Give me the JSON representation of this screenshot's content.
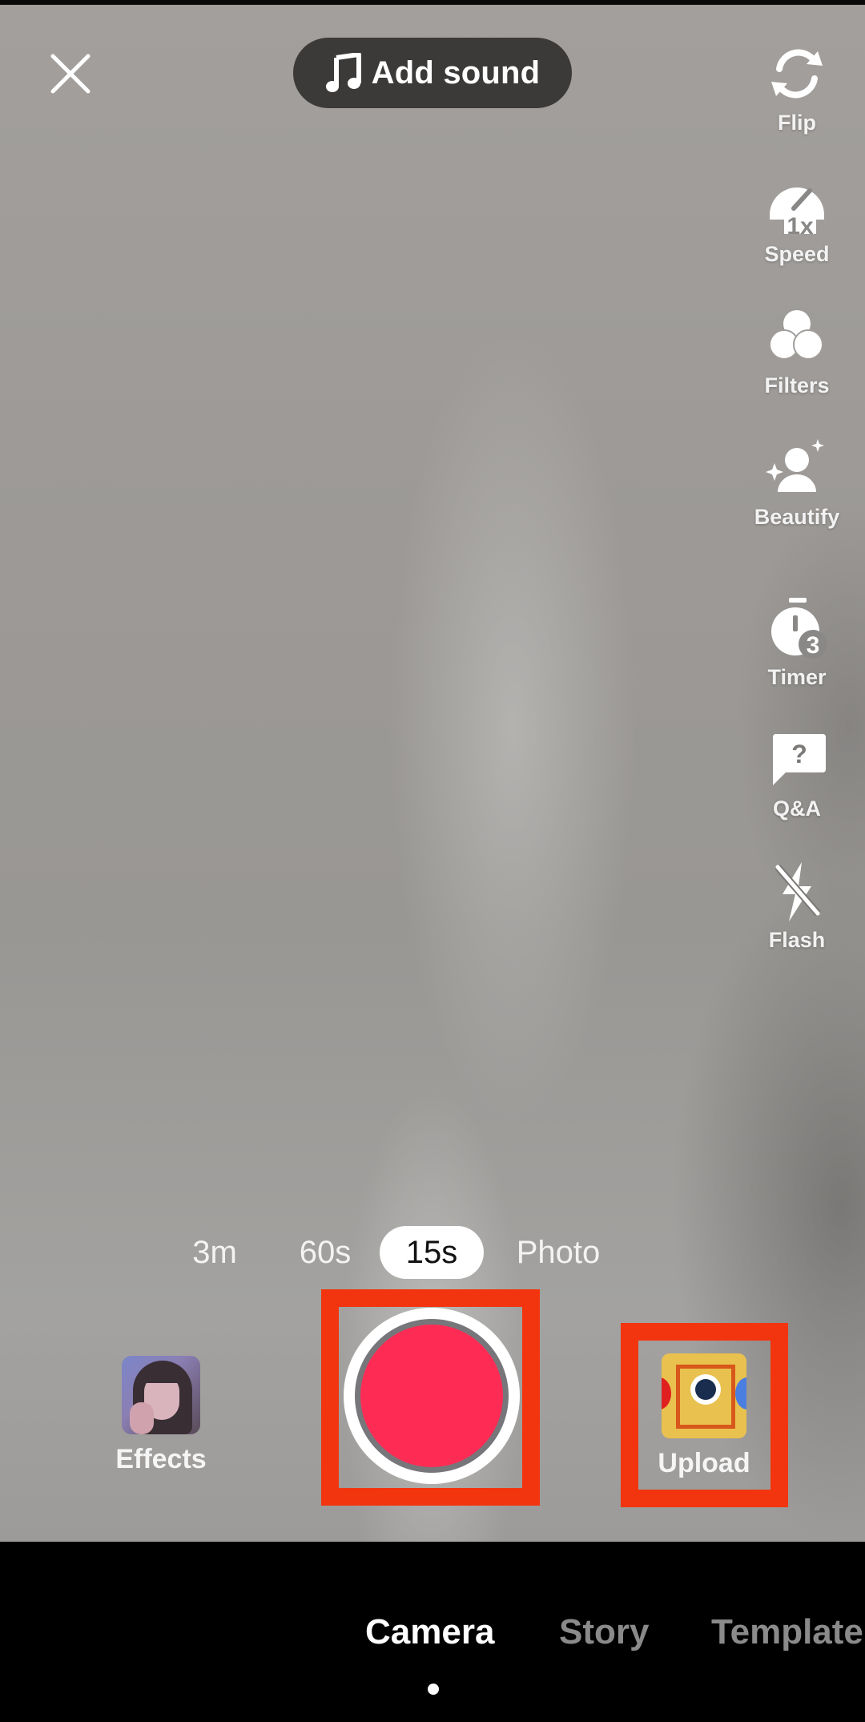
{
  "app": "TikTok camera",
  "header": {
    "close_icon": "close-icon",
    "add_sound_label": "Add sound",
    "add_sound_icon": "music-note-icon"
  },
  "side_tools": [
    {
      "label": "Flip",
      "icon": "flip-camera-icon"
    },
    {
      "label": "Speed",
      "icon": "speed-gauge-icon",
      "badge": "1x"
    },
    {
      "label": "Filters",
      "icon": "filters-icon"
    },
    {
      "label": "Beautify",
      "icon": "beautify-icon"
    },
    {
      "label": "Timer",
      "icon": "timer-icon",
      "badge": "3"
    },
    {
      "label": "Q&A",
      "icon": "qa-bubble-icon",
      "badge": "?"
    },
    {
      "label": "Flash",
      "icon": "flash-off-icon"
    }
  ],
  "duration_modes": [
    {
      "label": "3m",
      "active": false
    },
    {
      "label": "60s",
      "active": false
    },
    {
      "label": "15s",
      "active": true
    },
    {
      "label": "Photo",
      "active": false
    }
  ],
  "controls": {
    "effects_label": "Effects",
    "upload_label": "Upload",
    "record_color": "#fe2c55",
    "highlight_color": "#f2350f"
  },
  "bottom_tabs": [
    {
      "label": "Camera",
      "active": true
    },
    {
      "label": "Story",
      "active": false
    },
    {
      "label": "Template",
      "active": false
    }
  ]
}
